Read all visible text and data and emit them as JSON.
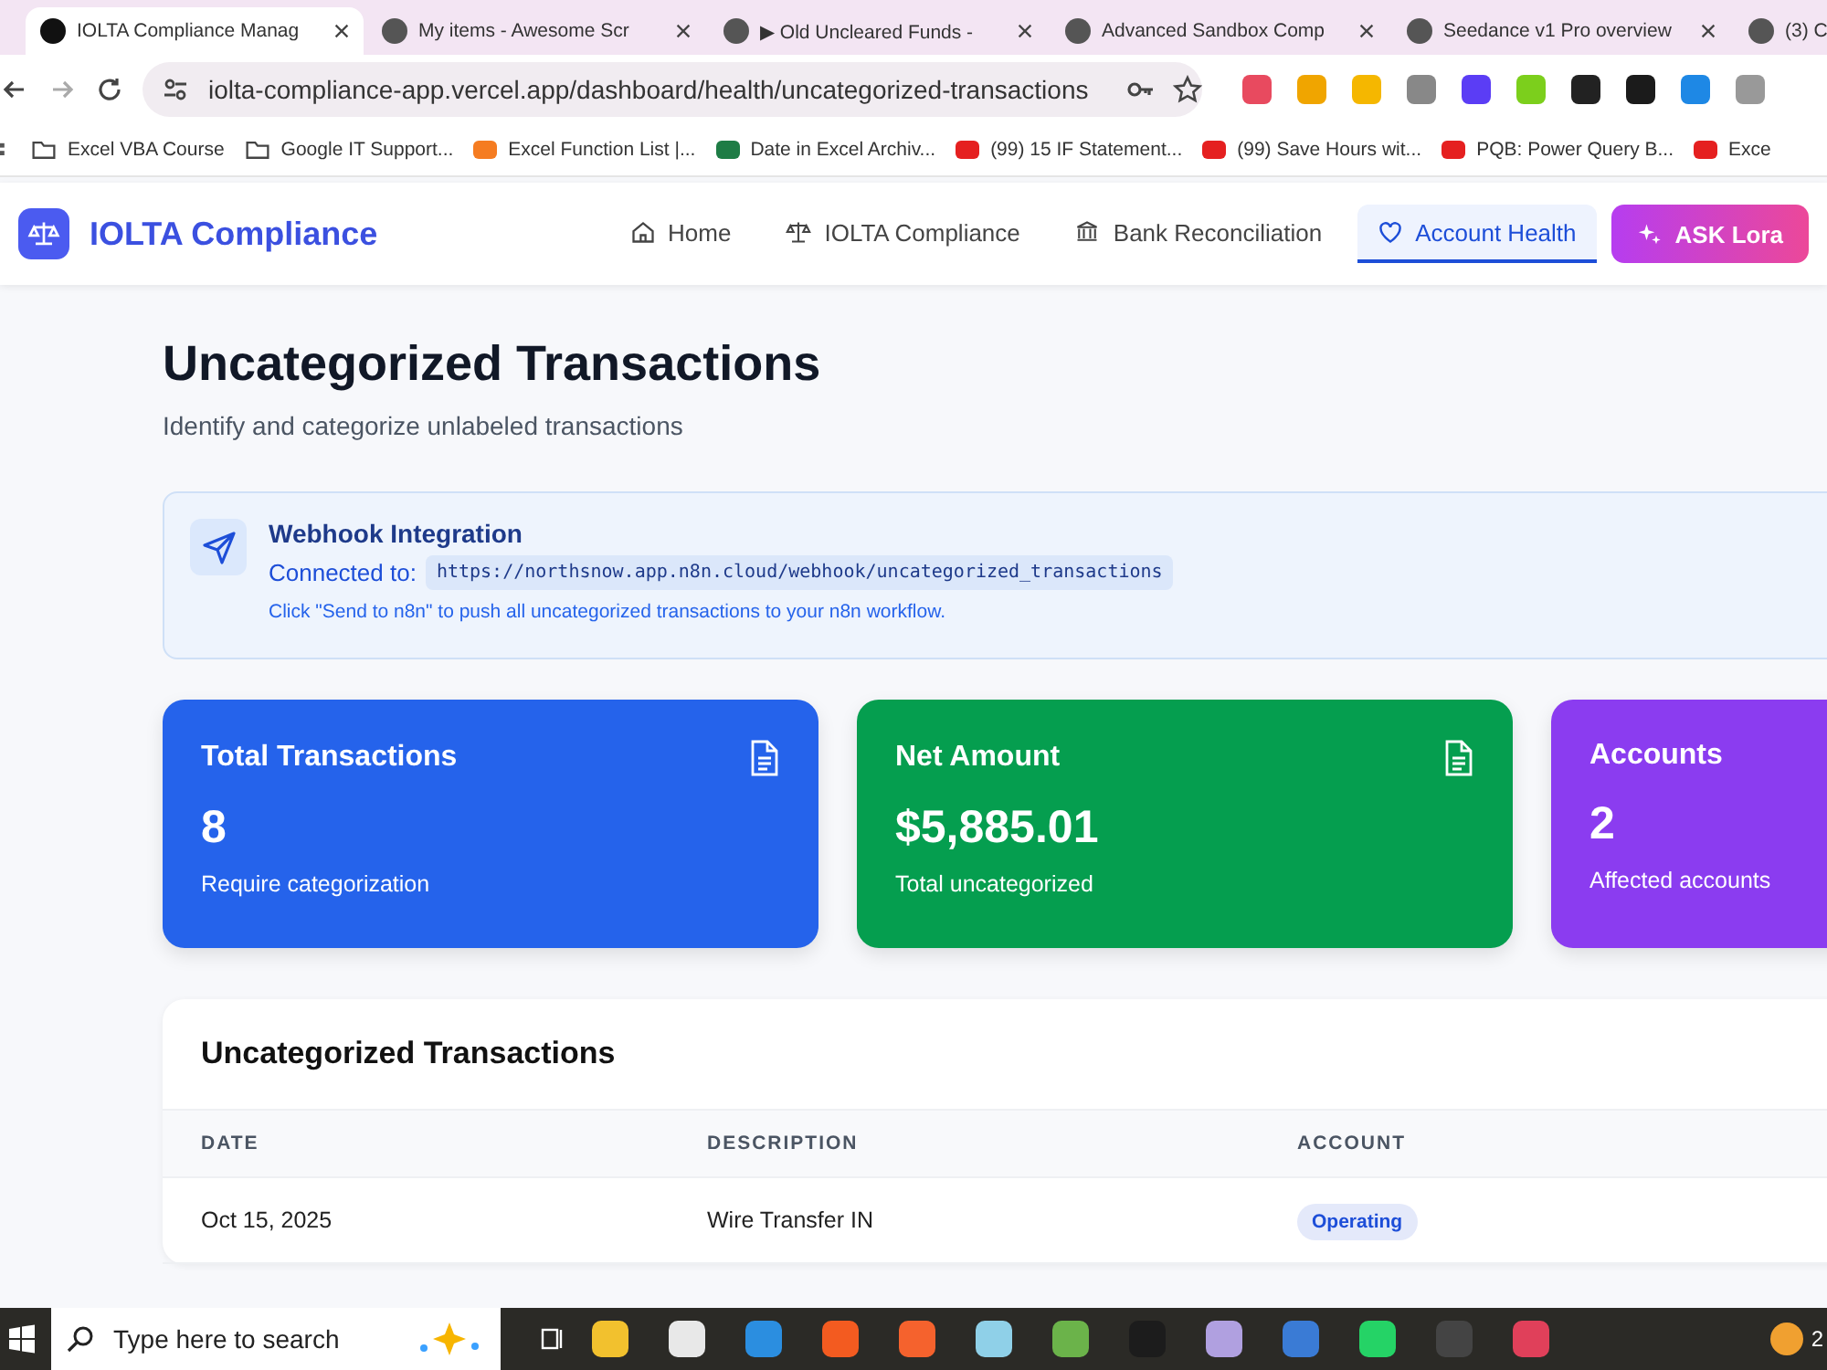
{
  "browser": {
    "tabs": [
      {
        "title": "IOLTA Compliance Manag",
        "selected": true
      },
      {
        "title": "My items - Awesome Scr",
        "selected": false
      },
      {
        "title": "▶ Old Uncleared Funds -",
        "selected": false
      },
      {
        "title": "Advanced Sandbox Comp",
        "selected": false
      },
      {
        "title": "Seedance v1 Pro overview",
        "selected": false
      },
      {
        "title": "(3) C",
        "selected": false
      }
    ],
    "address": "iolta-compliance-app.vercel.app/dashboard/health/uncategorized-transactions",
    "bookmarks": [
      "Excel VBA Course",
      "Google IT Support...",
      "Excel Function List |...",
      "Date in Excel Archiv...",
      "(99) 15 IF Statement...",
      "(99) Save Hours wit...",
      "PQB: Power Query B...",
      "Exce"
    ]
  },
  "app": {
    "brand": "IOLTA Compliance",
    "nav": [
      {
        "label": "Home",
        "kind": "link",
        "selected": false
      },
      {
        "label": "IOLTA Compliance",
        "kind": "link",
        "selected": false
      },
      {
        "label": "Bank Reconciliation",
        "kind": "link",
        "selected": false
      },
      {
        "label": "Account Health",
        "kind": "link",
        "selected": true
      },
      {
        "label": "ASK Lora",
        "kind": "cta"
      }
    ]
  },
  "page": {
    "title": "Uncategorized Transactions",
    "subtitle": "Identify and categorize unlabeled transactions"
  },
  "webhook": {
    "title": "Webhook Integration",
    "connected_label": "Connected to:",
    "url": "https://northsnow.app.n8n.cloud/webhook/uncategorized_transactions",
    "hint": "Click \"Send to n8n\" to push all uncategorized transactions to your n8n workflow."
  },
  "stats": [
    {
      "label": "Total Transactions",
      "value": "8",
      "caption": "Require categorization",
      "color": "#2563eb"
    },
    {
      "label": "Net Amount",
      "value": "$5,885.01",
      "caption": "Total uncategorized",
      "color": "#059e4f"
    },
    {
      "label": "Accounts",
      "value": "2",
      "caption": "Affected accounts",
      "color": "#8b3cf0"
    }
  ],
  "table": {
    "title": "Uncategorized Transactions",
    "columns": [
      "DATE",
      "DESCRIPTION",
      "ACCOUNT"
    ],
    "rows": [
      {
        "date": "Oct 15, 2025",
        "description": "Wire Transfer IN",
        "account": "Operating",
        "color": "#1d4ed8"
      }
    ]
  },
  "taskbar": {
    "search_placeholder": "Type here to search",
    "clock": "2"
  }
}
